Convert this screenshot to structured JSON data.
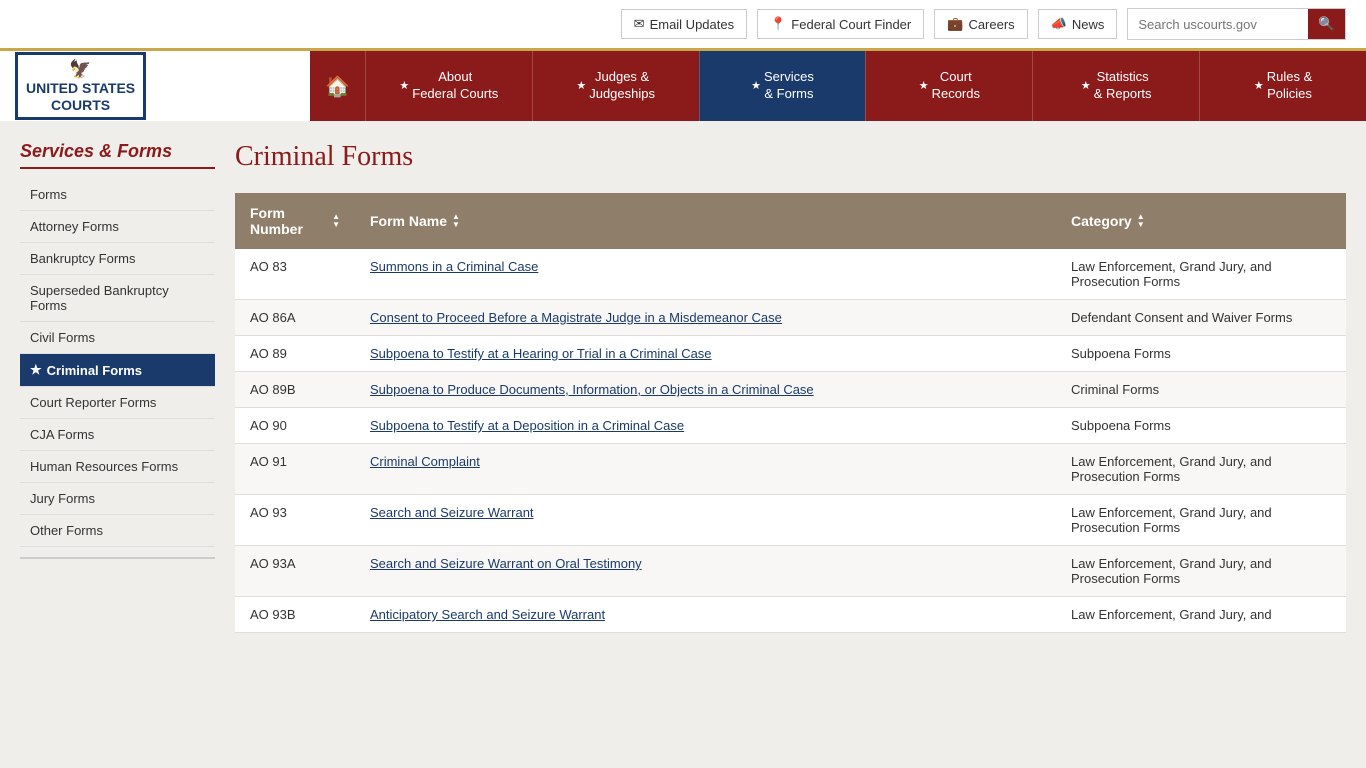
{
  "topbar": {
    "email_updates": "Email Updates",
    "federal_court_finder": "Federal Court Finder",
    "careers": "Careers",
    "news": "News",
    "search_placeholder": "Search uscourts.gov"
  },
  "nav": {
    "home_icon": "🏠",
    "items": [
      {
        "id": "about",
        "label": "About\nFederal Courts",
        "active": false
      },
      {
        "id": "judges",
        "label": "Judges &\nJudgeships",
        "active": false
      },
      {
        "id": "services",
        "label": "Services\n& Forms",
        "active": true
      },
      {
        "id": "court-records",
        "label": "Court\nRecords",
        "active": false
      },
      {
        "id": "statistics",
        "label": "Statistics\n& Reports",
        "active": false
      },
      {
        "id": "rules",
        "label": "Rules &\nPolicies",
        "active": false
      }
    ]
  },
  "logo": {
    "line1": "UNITED STATES",
    "line2": "COURTS"
  },
  "sidebar": {
    "title": "Services & Forms",
    "items": [
      {
        "id": "forms",
        "label": "Forms",
        "active": false
      },
      {
        "id": "attorney-forms",
        "label": "Attorney Forms",
        "active": false
      },
      {
        "id": "bankruptcy-forms",
        "label": "Bankruptcy Forms",
        "active": false
      },
      {
        "id": "superseded-bankruptcy",
        "label": "Superseded Bankruptcy Forms",
        "active": false
      },
      {
        "id": "civil-forms",
        "label": "Civil Forms",
        "active": false
      },
      {
        "id": "criminal-forms",
        "label": "Criminal Forms",
        "active": true
      },
      {
        "id": "court-reporter-forms",
        "label": "Court Reporter Forms",
        "active": false
      },
      {
        "id": "cja-forms",
        "label": "CJA Forms",
        "active": false
      },
      {
        "id": "human-resources-forms",
        "label": "Human Resources Forms",
        "active": false
      },
      {
        "id": "jury-forms",
        "label": "Jury Forms",
        "active": false
      },
      {
        "id": "other-forms",
        "label": "Other Forms",
        "active": false
      }
    ]
  },
  "page": {
    "title": "Criminal Forms",
    "table": {
      "headers": [
        {
          "id": "number",
          "label": "Form Number",
          "sortable": true
        },
        {
          "id": "name",
          "label": "Form Name",
          "sortable": true
        },
        {
          "id": "category",
          "label": "Category",
          "sortable": true
        }
      ],
      "rows": [
        {
          "number": "AO 83",
          "name": "Summons in a Criminal Case",
          "category": "Law Enforcement, Grand Jury, and Prosecution Forms"
        },
        {
          "number": "AO 86A",
          "name": "Consent to Proceed Before a Magistrate Judge in a Misdemeanor Case",
          "category": "Defendant Consent and Waiver Forms"
        },
        {
          "number": "AO 89",
          "name": "Subpoena to Testify at a Hearing or Trial in a Criminal Case",
          "category": "Subpoena Forms"
        },
        {
          "number": "AO 89B",
          "name": "Subpoena to Produce Documents, Information, or Objects in a Criminal Case",
          "category": "Criminal Forms"
        },
        {
          "number": "AO 90",
          "name": "Subpoena to Testify at a Deposition in a Criminal Case",
          "category": "Subpoena Forms"
        },
        {
          "number": "AO 91",
          "name": "Criminal Complaint",
          "category": "Law Enforcement, Grand Jury, and Prosecution Forms"
        },
        {
          "number": "AO 93",
          "name": "Search and Seizure Warrant",
          "category": "Law Enforcement, Grand Jury, and Prosecution Forms"
        },
        {
          "number": "AO 93A",
          "name": "Search and Seizure Warrant on Oral Testimony",
          "category": "Law Enforcement, Grand Jury, and Prosecution Forms"
        },
        {
          "number": "AO 93B",
          "name": "Anticipatory Search and Seizure Warrant",
          "category": "Law Enforcement, Grand Jury, and"
        }
      ]
    }
  }
}
